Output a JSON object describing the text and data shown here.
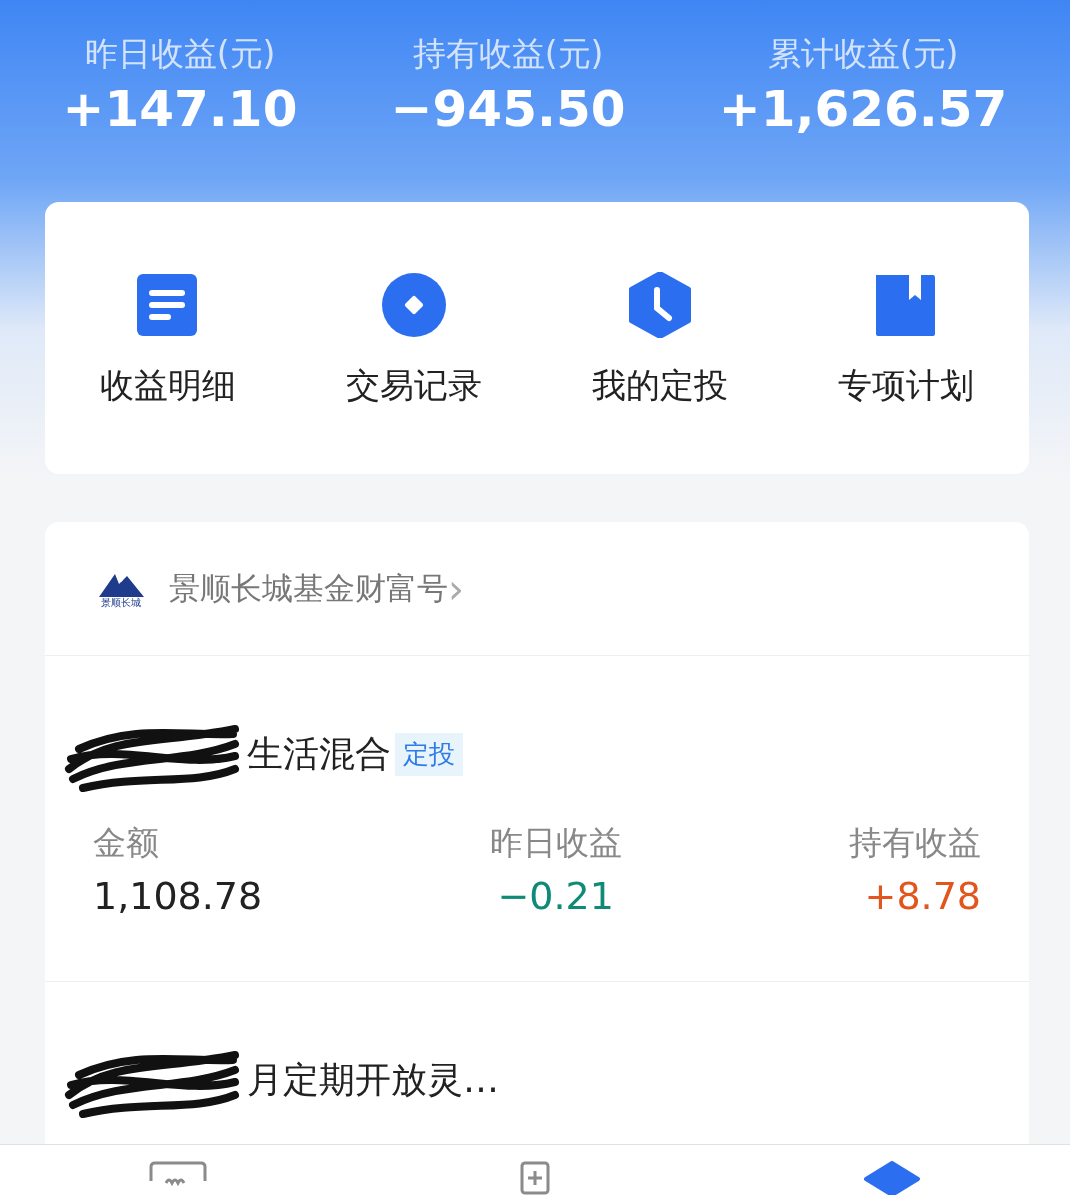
{
  "summary": [
    {
      "label": "昨日收益(元)",
      "value": "+147.10"
    },
    {
      "label": "持有收益(元)",
      "value": "−945.50"
    },
    {
      "label": "累计收益(元)",
      "value": "+1,626.57"
    }
  ],
  "shortcuts": [
    {
      "kind": "doc",
      "label": "收益明细"
    },
    {
      "kind": "coin",
      "label": "交易记录"
    },
    {
      "kind": "clock",
      "label": "我的定投"
    },
    {
      "kind": "book",
      "label": "专项计划"
    }
  ],
  "account": {
    "logo_text": "景顺长城",
    "name": "景顺长城基金财富号",
    "arrow": "›"
  },
  "funds": [
    {
      "name": "生活混合",
      "redacted": true,
      "tag": "定投",
      "stats": [
        {
          "label": "金额",
          "value": "1,108.78",
          "color": "#222222"
        },
        {
          "label": "昨日收益",
          "value": "−0.21",
          "color": "#0f8a76"
        },
        {
          "label": "持有收益",
          "value": "+8.78",
          "color": "#e2561d"
        }
      ]
    },
    {
      "name": "月定期开放灵…",
      "redacted": true
    }
  ],
  "bottom_nav": [
    {
      "kind": "chat",
      "selected": false
    },
    {
      "kind": "plus",
      "selected": false
    },
    {
      "kind": "diamond",
      "selected": true
    }
  ]
}
